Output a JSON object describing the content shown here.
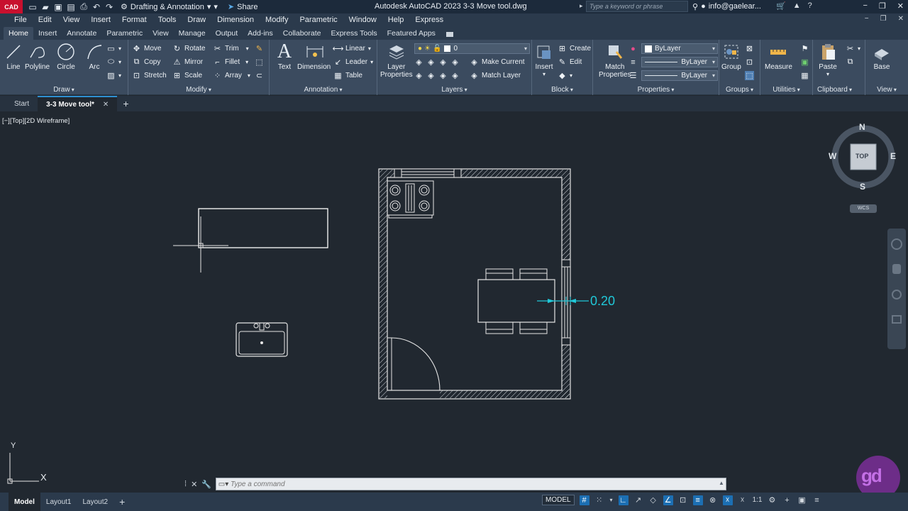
{
  "titlebar": {
    "app_badge": "CAD",
    "workspace": "Drafting & Annotation",
    "share": "Share",
    "title": "Autodesk AutoCAD 2023    3-3 Move tool.dwg",
    "search_placeholder": "Type a keyword or phrase",
    "user": "info@gaelear...",
    "qat_icons": [
      "new-icon",
      "open-icon",
      "save-icon",
      "saveas-icon",
      "print-icon",
      "undo-icon",
      "redo-icon"
    ]
  },
  "menu": [
    "File",
    "Edit",
    "View",
    "Insert",
    "Format",
    "Tools",
    "Draw",
    "Dimension",
    "Modify",
    "Parametric",
    "Window",
    "Help",
    "Express"
  ],
  "ribbon_tabs": [
    "Home",
    "Insert",
    "Annotate",
    "Parametric",
    "View",
    "Manage",
    "Output",
    "Add-ins",
    "Collaborate",
    "Express Tools",
    "Featured Apps"
  ],
  "ribbon": {
    "draw": {
      "title": "Draw",
      "line": "Line",
      "polyline": "Polyline",
      "circle": "Circle",
      "arc": "Arc"
    },
    "modify": {
      "title": "Modify",
      "move": "Move",
      "rotate": "Rotate",
      "trim": "Trim",
      "copy": "Copy",
      "mirror": "Mirror",
      "fillet": "Fillet",
      "stretch": "Stretch",
      "scale": "Scale",
      "array": "Array"
    },
    "annotation": {
      "title": "Annotation",
      "text": "Text",
      "dimension": "Dimension",
      "linear": "Linear",
      "leader": "Leader",
      "table": "Table"
    },
    "layers": {
      "title": "Layers",
      "layer_properties_1": "Layer",
      "layer_properties_2": "Properties",
      "current_layer": "0",
      "make_current": "Make Current",
      "match_layer": "Match Layer"
    },
    "block": {
      "title": "Block",
      "insert": "Insert",
      "create": "Create",
      "edit": "Edit"
    },
    "properties": {
      "title": "Properties",
      "match_1": "Match",
      "match_2": "Properties",
      "color": "ByLayer",
      "linetype": "ByLayer",
      "lineweight": "ByLayer"
    },
    "groups": {
      "title": "Groups",
      "group": "Group"
    },
    "utilities": {
      "title": "Utilities",
      "measure": "Measure"
    },
    "clipboard": {
      "title": "Clipboard",
      "paste": "Paste"
    },
    "view": {
      "title": "View",
      "base": "Base"
    }
  },
  "file_tabs": {
    "start": "Start",
    "active": "3-3 Move tool*",
    "close": "✕",
    "add": "+"
  },
  "canvas": {
    "view_label": "[−][Top][2D Wireframe]",
    "dimension_value": "0.20",
    "viewcube": {
      "top": "TOP",
      "n": "N",
      "s": "S",
      "e": "E",
      "w": "W",
      "wcs": "WCS"
    },
    "ucs_x": "X",
    "ucs_y": "Y"
  },
  "command": {
    "placeholder": "Type a command"
  },
  "layout_tabs": [
    "Model",
    "Layout1",
    "Layout2"
  ],
  "status": {
    "model": "MODEL",
    "scale": "1:1"
  },
  "colors": {
    "canvas": "#212830",
    "ribbon": "#3b4b5f",
    "dimension": "#20c8d8",
    "brand": "#c8102e"
  }
}
